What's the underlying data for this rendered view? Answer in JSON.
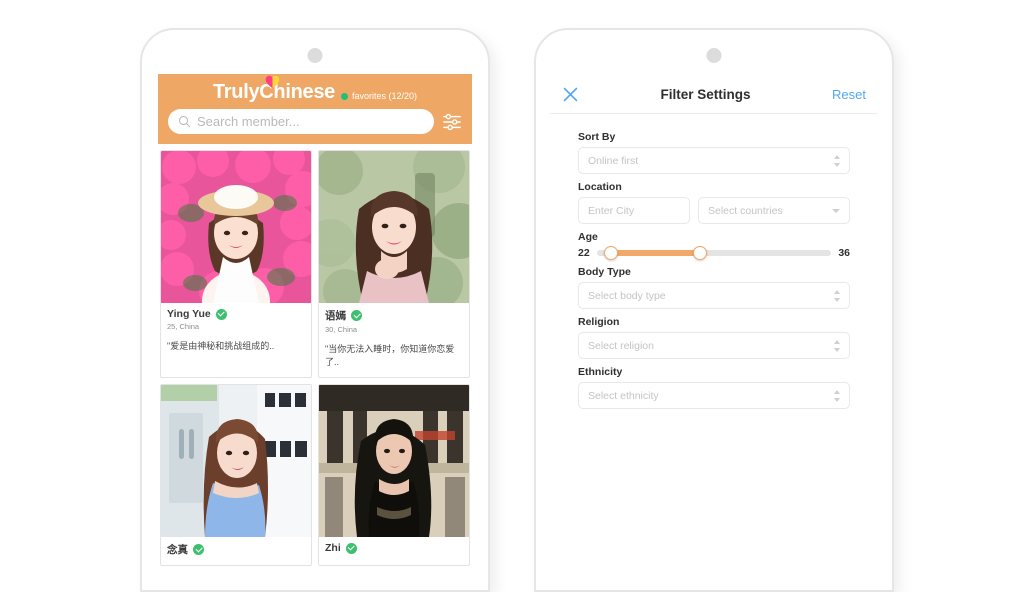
{
  "app": {
    "brand_truly": "Truly",
    "brand_chinese": "Chinese",
    "favorites_label": "favorites (12/20)",
    "search_placeholder": "Search member...",
    "icons": {
      "search": "search-icon",
      "filter": "filter-sliders-icon",
      "heart": "heart-icon",
      "online_dot": "online-status-dot"
    },
    "colors": {
      "header_orange": "#efa766",
      "verified_green": "#3cbf6e",
      "online_green": "#21c07a",
      "accent_blue": "#53a7f5",
      "slider_orange": "#f2a868"
    }
  },
  "members": [
    {
      "name": "Ying Yue",
      "age_location": "25, China",
      "quote": "\"爱是由神秘和挑战组成的..",
      "verified": true,
      "photo": "woman-straw-hat-pink-flowers"
    },
    {
      "name": "语嫣",
      "age_location": "30, China",
      "quote": "\"当你无法入睡时，你知道你恋爱了..",
      "verified": true,
      "photo": "woman-pink-top-green-bokeh"
    },
    {
      "name": "念真",
      "age_location": "",
      "quote": "",
      "verified": true,
      "photo": "woman-blue-offshoulder-white-wall"
    },
    {
      "name": "Zhi",
      "age_location": "",
      "quote": "",
      "verified": true,
      "photo": "woman-black-outfit-building"
    }
  ],
  "filter": {
    "title": "Filter Settings",
    "close_icon": "close-x-icon",
    "reset_label": "Reset",
    "fields": {
      "sort_by": {
        "label": "Sort By",
        "placeholder": "Online first"
      },
      "location": {
        "label": "Location",
        "city_placeholder": "Enter City",
        "country_placeholder": "Select countries"
      },
      "age": {
        "label": "Age",
        "min": "22",
        "max": "36",
        "min_pct": 6,
        "max_pct": 44
      },
      "body_type": {
        "label": "Body Type",
        "placeholder": "Select body type"
      },
      "religion": {
        "label": "Religion",
        "placeholder": "Select religion"
      },
      "ethnicity": {
        "label": "Ethnicity",
        "placeholder": "Select ethnicity"
      }
    }
  }
}
